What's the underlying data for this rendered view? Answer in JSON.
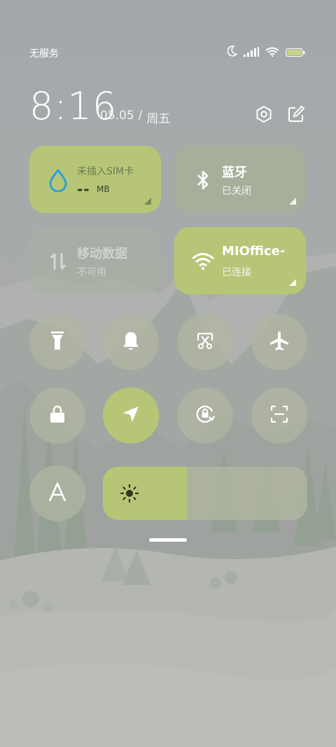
{
  "status_bar": {
    "carrier": "无服务",
    "icons": [
      "moon-icon",
      "signal-icon",
      "wifi-icon",
      "battery-icon"
    ]
  },
  "header": {
    "time": "8:16",
    "date": "05.05",
    "separator": "/",
    "weekday": "周五",
    "icons": [
      "settings-icon",
      "edit-icon"
    ]
  },
  "tiles": {
    "sim": {
      "title": "未插入SIM卡",
      "data_value": "--",
      "data_unit": "MB",
      "icon": "water-drop-icon",
      "active": true
    },
    "bluetooth": {
      "title": "蓝牙",
      "subtitle": "已关闭",
      "icon": "bluetooth-icon",
      "active": false
    },
    "mobile_data": {
      "title": "移动数据",
      "subtitle": "不可用",
      "icon": "data-arrows-icon",
      "active": false
    },
    "wifi": {
      "title": "MIOffice-",
      "subtitle": "已连接",
      "icon": "wifi-icon",
      "active": true
    }
  },
  "toggles": [
    {
      "name": "flashlight",
      "icon": "flashlight-icon",
      "active": false
    },
    {
      "name": "bell",
      "icon": "bell-icon",
      "active": false
    },
    {
      "name": "screenshot",
      "icon": "scissors-screenshot-icon",
      "active": false
    },
    {
      "name": "airplane",
      "icon": "airplane-icon",
      "active": false
    },
    {
      "name": "lock",
      "icon": "lock-icon",
      "active": false
    },
    {
      "name": "location",
      "icon": "location-arrow-icon",
      "active": true
    },
    {
      "name": "rotation-lock",
      "icon": "rotation-lock-icon",
      "active": false
    },
    {
      "name": "scanner",
      "icon": "scan-icon",
      "active": false
    },
    {
      "name": "font",
      "icon": "font-a-icon",
      "active": false
    }
  ],
  "brightness": {
    "level": 0.41,
    "icon": "sun-icon"
  },
  "colors": {
    "accent": "#b6c676",
    "tile_off": "#a8b296",
    "sim_icon": "#2f9fd9"
  }
}
